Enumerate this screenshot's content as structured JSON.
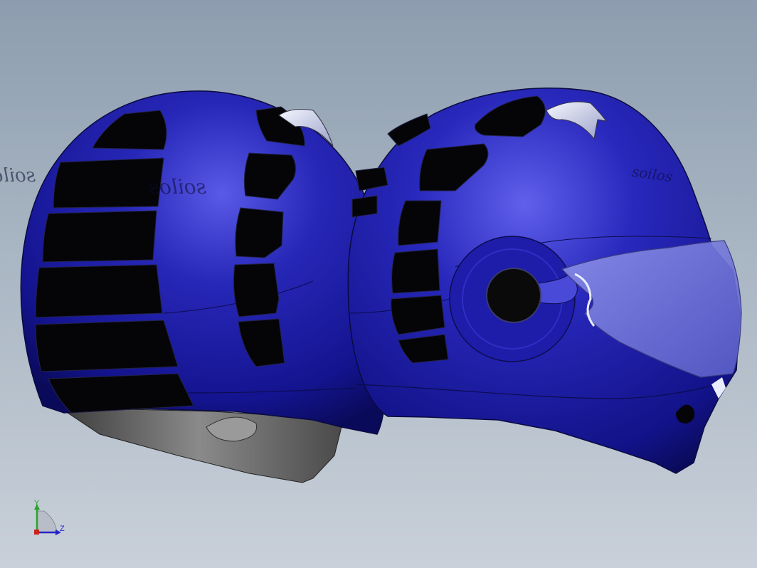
{
  "viewport": {
    "background_top": "#8d9daf",
    "background_bottom": "#c9d0d9"
  },
  "model": {
    "helmet_color": "#1a1aa8",
    "vent_color": "#050508",
    "visor_tint": "#9a9ee6",
    "liner_color": "#6e6e6e",
    "logo_rear": "soilos",
    "logo_front": "soilos",
    "logo_top_right": "soilos"
  },
  "triad": {
    "y_label": "Y",
    "z_label": "Z",
    "y_color": "#28a428",
    "z_color": "#2424c8"
  }
}
